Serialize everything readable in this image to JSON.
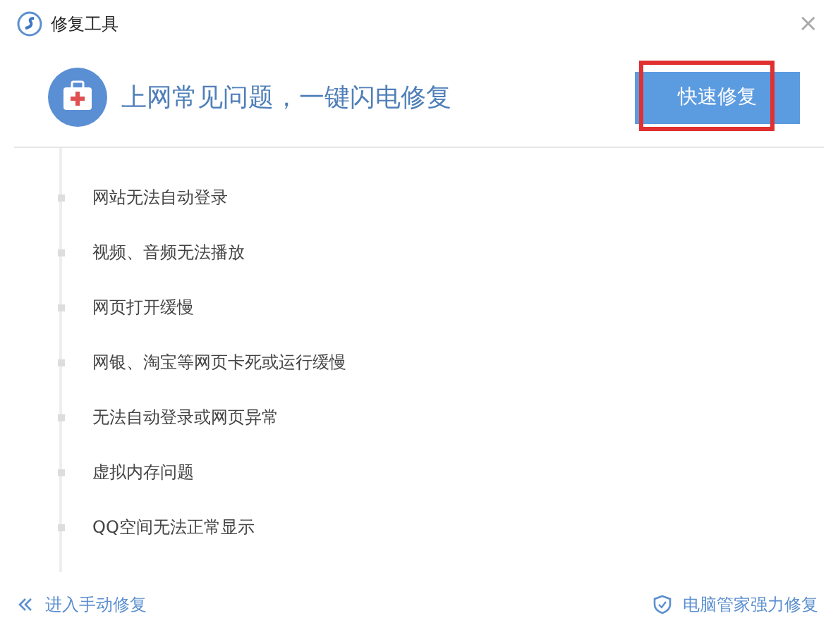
{
  "window": {
    "title": "修复工具",
    "close": "×"
  },
  "header": {
    "headline": "上网常见问题，一键闪电修复",
    "button": "快速修复",
    "button_highlighted": true
  },
  "problems": [
    "网站无法自动登录",
    "视频、音频无法播放",
    "网页打开缓慢",
    "网银、淘宝等网页卡死或运行缓慢",
    "无法自动登录或网页异常",
    "虚拟内存问题",
    "QQ空间无法正常显示"
  ],
  "footer": {
    "manual_link": "进入手动修复",
    "strong_link": "电脑管家强力修复"
  }
}
